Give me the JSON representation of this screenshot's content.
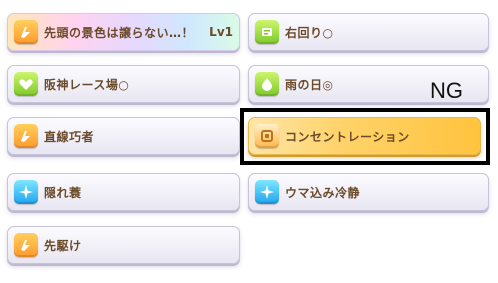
{
  "skills": [
    {
      "label": "先頭の景色は譲らない…！",
      "level": "Lv1",
      "icon": "speed-icon",
      "style": "rainbow"
    },
    {
      "label": "右回り○",
      "icon": "speed-icon",
      "style": "normal"
    },
    {
      "label": "阪神レース場○",
      "icon": "heart-icon",
      "style": "normal"
    },
    {
      "label": "雨の日◎",
      "icon": "speed-icon",
      "style": "normal"
    },
    {
      "label": "直線巧者",
      "icon": "speed-icon",
      "style": "normal"
    },
    {
      "label": "コンセントレーション",
      "icon": "speed-icon",
      "style": "gold"
    },
    {
      "label": "隠れ蓑",
      "icon": "sparkle-icon",
      "style": "normal"
    },
    {
      "label": "ウマ込み冷静",
      "icon": "sparkle-icon",
      "style": "normal"
    },
    {
      "label": "先駆け",
      "icon": "speed-icon",
      "style": "normal"
    }
  ],
  "annotation": {
    "ng_text": "NG"
  },
  "colors": {
    "label_text": "#6b4a2a",
    "highlight_border": "#000000",
    "gold_card": "#ffc33e",
    "icon_orange": "#ff9a2e",
    "icon_green": "#7ec92a",
    "icon_blue": "#1fa3ef"
  }
}
